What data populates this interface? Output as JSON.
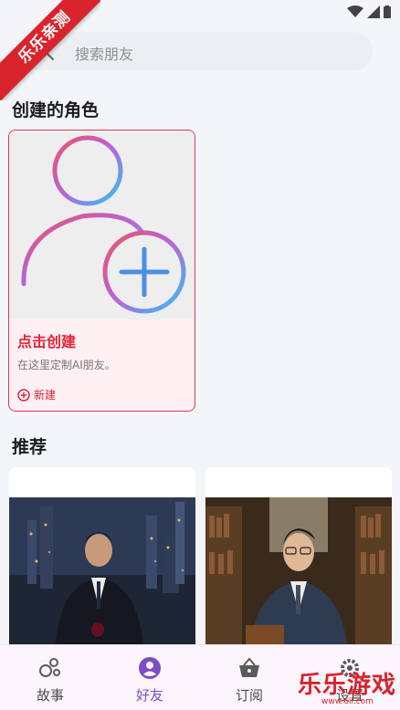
{
  "watermark": {
    "corner_text": "乐乐亲测",
    "brand_text": "乐乐游戏",
    "url": "www.6ll.com"
  },
  "search": {
    "placeholder": "搜索朋友"
  },
  "sections": {
    "created": "创建的角色",
    "recommended": "推荐"
  },
  "create_card": {
    "title": "点击创建",
    "description": "在这里定制AI朋友。",
    "new_label": "新建"
  },
  "nav": [
    {
      "label": "故事",
      "icon": "story-icon",
      "active": false
    },
    {
      "label": "好友",
      "icon": "friend-icon",
      "active": true
    },
    {
      "label": "订阅",
      "icon": "basket-icon",
      "active": false
    },
    {
      "label": "设置",
      "icon": "gear-icon",
      "active": false
    }
  ],
  "colors": {
    "accent": "#e8203a",
    "active_nav": "#7c4dc4",
    "card_border": "#e9334f",
    "watermark": "#d9232d"
  }
}
